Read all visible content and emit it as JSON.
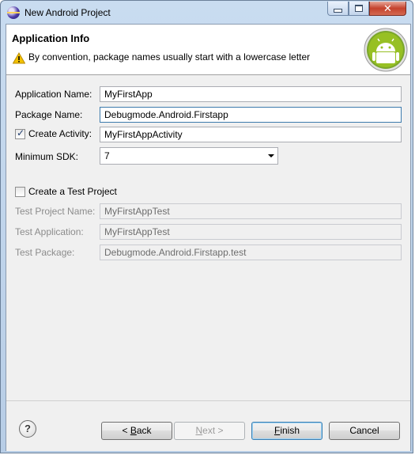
{
  "window": {
    "title": "New Android Project",
    "close_glyph": "✕"
  },
  "header": {
    "title": "Application Info",
    "message": "By convention, package names usually start with a lowercase letter",
    "warning_icon": "warning-icon",
    "logo": "android-logo"
  },
  "form": {
    "application_name_label": "Application Name:",
    "application_name": "MyFirstApp",
    "package_name_label": "Package Name:",
    "package_name": "Debugmode.Android.Firstapp",
    "create_activity_label": "Create Activity:",
    "create_activity_checked": true,
    "activity_name": "MyFirstAppActivity",
    "min_sdk_label": "Minimum SDK:",
    "min_sdk": "7"
  },
  "test_project": {
    "create_label": "Create a Test Project",
    "checked": false,
    "project_name_label": "Test Project Name:",
    "project_name": "MyFirstAppTest",
    "application_label": "Test Application:",
    "application": "MyFirstAppTest",
    "package_label": "Test Package:",
    "package": "Debugmode.Android.Firstapp.test"
  },
  "footer": {
    "help_glyph": "?",
    "back_prefix": "< ",
    "back_key": "B",
    "back_rest": "ack",
    "next_key": "N",
    "next_rest": "ext >",
    "finish_key": "F",
    "finish_rest": "inish",
    "cancel_label": "Cancel"
  },
  "colors": {
    "accent_focus": "#3d7bad",
    "warning": "#f2c100",
    "android_green": "#97c024"
  }
}
